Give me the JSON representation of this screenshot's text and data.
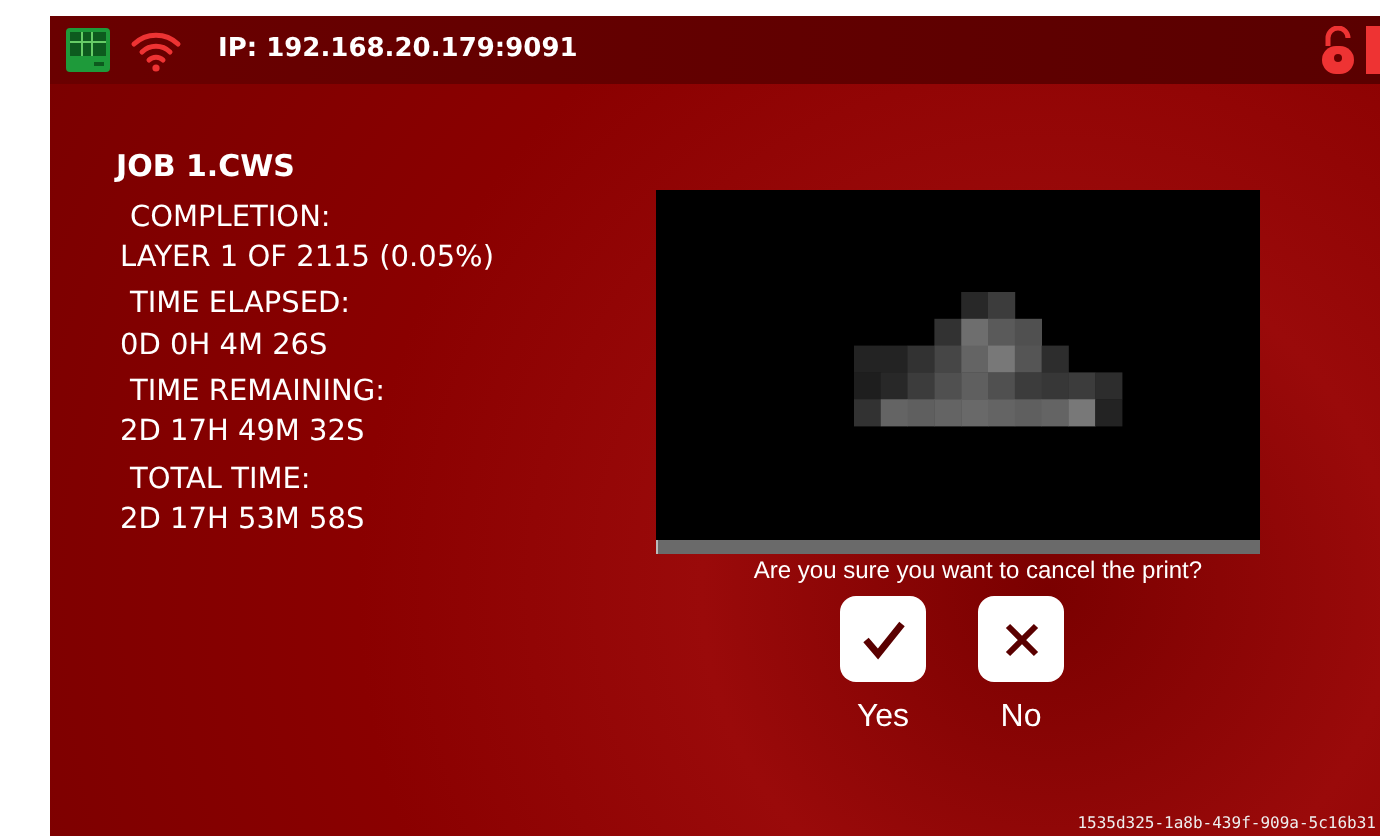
{
  "status_bar": {
    "ip": "IP: 192.168.20.179:9091"
  },
  "job": {
    "title": "JOB 1.CWS",
    "stats": [
      {
        "label": "COMPLETION:",
        "value": "LAYER 1 OF 2115 (0.05%)"
      },
      {
        "label": "TIME ELAPSED:",
        "value": "0D 0H 4M 26S"
      },
      {
        "label": "TIME REMAINING:",
        "value": "2D 17H 49M 32S"
      },
      {
        "label": "TOTAL TIME:",
        "value": "2D 17H 53M 58S"
      }
    ]
  },
  "preview": {
    "progress": {
      "level": 0.0005
    }
  },
  "dialog": {
    "question": "Are you sure you want to cancel the print?",
    "buttons": [
      {
        "kind": "yes",
        "label": "Yes"
      },
      {
        "kind": "no",
        "label": "No"
      }
    ]
  },
  "footer_id": "1535d325-1a8b-439f-909a-5c16b31"
}
